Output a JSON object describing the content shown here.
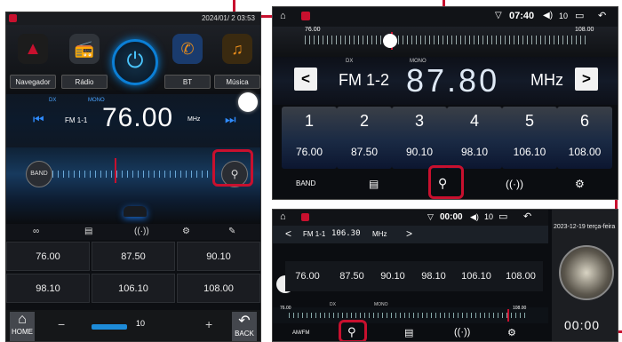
{
  "left": {
    "datetime": "2024/01/ 2 03:53",
    "apps": [
      {
        "label": "Navegador",
        "icon": "compass-icon",
        "color": "#c8102e"
      },
      {
        "label": "Rádio",
        "icon": "radio-icon",
        "color": "#9aa0a8"
      },
      {
        "label": "",
        "icon": "power-icon",
        "color": "#0b7fd6"
      },
      {
        "label": "BT",
        "icon": "bluetooth-icon",
        "color": "#e58b1b"
      },
      {
        "label": "Música",
        "icon": "music-icon",
        "color": "#e58b1b"
      }
    ],
    "dx": "DX",
    "mono": "MONO",
    "band": "FM 1-1",
    "frequency": "76.00",
    "unit": "MHz",
    "band_button": "BAND",
    "presets": [
      "76.00",
      "87.50",
      "90.10",
      "98.10",
      "106.10",
      "108.00"
    ],
    "home": "HOME",
    "back": "BACK",
    "volume": "10",
    "minus": "−",
    "plus": "+"
  },
  "top_right": {
    "time": "07:40",
    "volume": "10",
    "scale_min": "76.00",
    "scale_max": "108.00",
    "dx": "DX",
    "mono": "MONO",
    "band": "FM 1-2",
    "frequency": "87.80",
    "unit": "MHz",
    "prev": "<",
    "next": ">",
    "presets": [
      {
        "n": "1",
        "f": "76.00"
      },
      {
        "n": "2",
        "f": "87.50"
      },
      {
        "n": "3",
        "f": "90.10"
      },
      {
        "n": "4",
        "f": "98.10"
      },
      {
        "n": "5",
        "f": "106.10"
      },
      {
        "n": "6",
        "f": "108.00"
      }
    ],
    "band_button": "BAND"
  },
  "bottom_right": {
    "time": "00:00",
    "volume": "10",
    "band": "FM 1-1",
    "frequency": "106.30",
    "unit": "MHz",
    "presets": [
      "76.00",
      "87.50",
      "90.10",
      "98.10",
      "106.10",
      "108.00"
    ],
    "dx": "DX",
    "mono": "MONO",
    "scale_min": "76.00",
    "scale_max": "108.00",
    "band_button": "AM/FM",
    "side_date": "2023-12-19 terça-feira",
    "side_time": "00:00"
  }
}
